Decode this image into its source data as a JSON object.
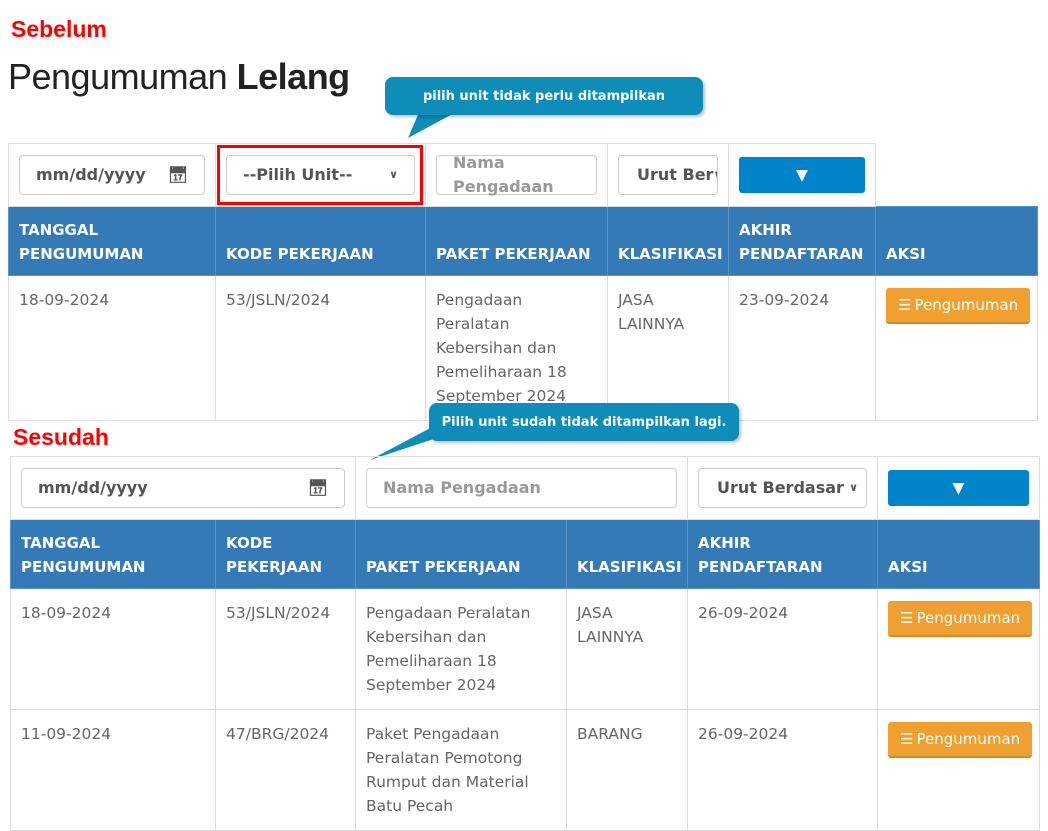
{
  "before": {
    "label": "Sebelum",
    "title_light": "Pengumuman",
    "title_bold": "Lelang",
    "callout": "pilih unit tidak perlu ditampilkan",
    "filters": {
      "date": "mm/dd/yyyy",
      "unit": "--Pilih Unit--",
      "nama_placeholder": "Nama Pengadaan",
      "sort": "Urut Ber"
    },
    "headers": [
      "TANGGAL PENGUMUMAN",
      "KODE PEKERJAAN",
      "PAKET PEKERJAAN",
      "KLASIFIKASI",
      "AKHIR PENDAFTARAN",
      "AKSI"
    ],
    "rows": [
      {
        "tanggal": "18-09-2024",
        "kode": "53/JSLN/2024",
        "paket": "Pengadaan Peralatan Kebersihan dan Pemeliharaan 18 September 2024",
        "klasifikasi": "JASA LAINNYA",
        "akhir": "23-09-2024",
        "aksi": "Pengumuman"
      }
    ]
  },
  "after": {
    "label": "Sesudah",
    "callout": "Pilih unit sudah tidak ditampilkan lagi.",
    "filters": {
      "date": "mm/dd/yyyy",
      "nama_placeholder": "Nama Pengadaan",
      "sort": "Urut Berdasar"
    },
    "headers": [
      "TANGGAL PENGUMUMAN",
      "KODE PEKERJAAN",
      "PAKET PEKERJAAN",
      "KLASIFIKASI",
      "AKHIR PENDAFTARAN",
      "AKSI"
    ],
    "rows": [
      {
        "tanggal": "18-09-2024",
        "kode": "53/JSLN/2024",
        "paket": "Pengadaan Peralatan Kebersihan dan Pemeliharaan 18 September 2024",
        "klasifikasi": "JASA LAINNYA",
        "akhir": "26-09-2024",
        "aksi": "Pengumuman"
      },
      {
        "tanggal": "11-09-2024",
        "kode": "47/BRG/2024",
        "paket": "Paket Pengadaan Peralatan Pemotong Rumput dan Material Batu Pecah",
        "klasifikasi": "BARANG",
        "akhir": "26-09-2024",
        "aksi": "Pengumuman"
      }
    ]
  },
  "colors": {
    "header": "#337ab7",
    "callout": "#0e8db8",
    "button_filter": "#0084c9",
    "button_action": "#f0a030",
    "annotation": "#ff0000"
  }
}
